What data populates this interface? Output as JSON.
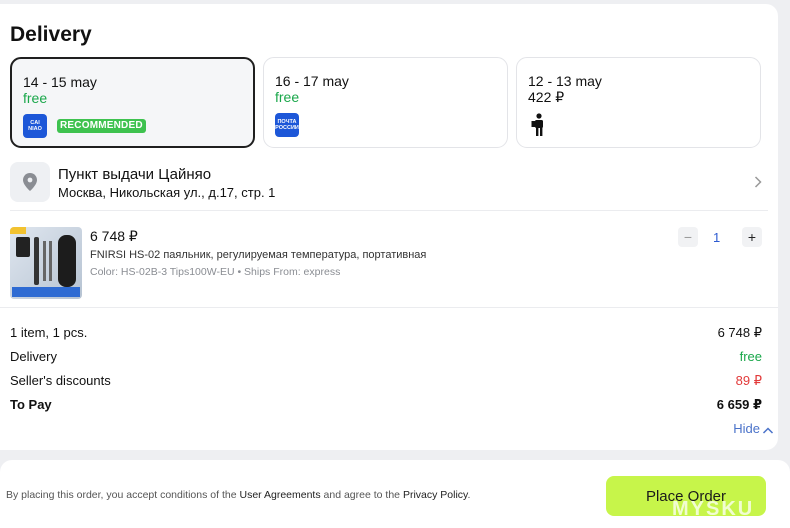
{
  "section": {
    "title": "Delivery"
  },
  "options": [
    {
      "date": "14 - 15 may",
      "price": "free",
      "logo_text": "CAI NIAO",
      "badge": "RECOMMENDED",
      "selected": true
    },
    {
      "date": "16 - 17 may",
      "price": "free",
      "logo_text": "ПОЧТА РОССИИ"
    },
    {
      "date": "12 - 13 may",
      "price": "422 ₽",
      "icon": "courier-icon"
    }
  ],
  "pickup": {
    "name": "Пункт выдачи Цайняо",
    "address": "Москва, Никольская ул., д.17, стр. 1"
  },
  "product": {
    "price": "6 748 ₽",
    "name": "FNIRSI HS-02 паяльник, регулируемая температура, портативная",
    "meta": "Color: HS-02B-3 Tips100W-EU • Ships From: express",
    "minus": "−",
    "plus": "+",
    "quantity": "1"
  },
  "summary": {
    "items_label": "1 item, 1 pcs.",
    "items_value": "6 748 ₽",
    "delivery_label": "Delivery",
    "delivery_value": "free",
    "discount_label": "Seller's discounts",
    "discount_value": "89 ₽",
    "pay_label": "To Pay",
    "pay_value": "6 659 ₽",
    "hide": "Hide"
  },
  "footer": {
    "terms_1": "By placing this order, you accept conditions of the ",
    "user_agreements": "User Agreements",
    "terms_2": " and agree to the ",
    "privacy": "Privacy Policy",
    "terms_3": ".",
    "order_button": "Place Order"
  },
  "watermark": "MYSKU",
  "colors": {
    "accent_green": "#19a74a",
    "discount_red": "#e23a3a",
    "button": "#c7f54a"
  }
}
